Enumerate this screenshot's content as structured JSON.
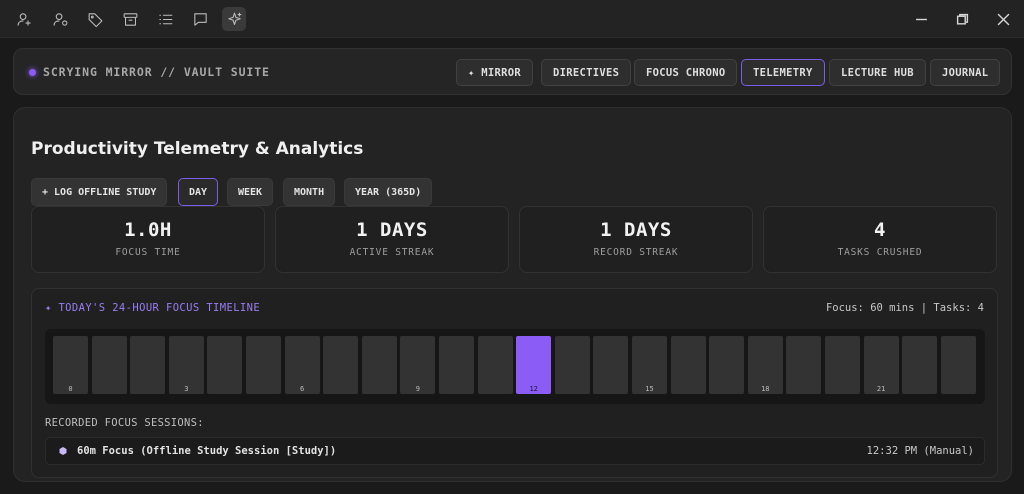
{
  "toolbar": {
    "icons": [
      "user-plus-icon",
      "user-add-icon",
      "tag-icon",
      "archive-icon",
      "list-icon",
      "chat-icon",
      "sparkle-icon"
    ]
  },
  "window": {
    "minimize": "minimize-icon",
    "restore": "restore-icon",
    "close": "close-icon"
  },
  "header": {
    "brand": "SCRYING MIRROR // VAULT SUITE",
    "nav": [
      {
        "label": "✦ MIRROR",
        "active": false
      },
      {
        "label": "DIRECTIVES",
        "active": false
      },
      {
        "label": "FOCUS CHRONO",
        "active": false
      },
      {
        "label": "TELEMETRY",
        "active": true
      },
      {
        "label": "LECTURE HUB",
        "active": false
      },
      {
        "label": "JOURNAL",
        "active": false
      }
    ]
  },
  "main": {
    "title": "Productivity Telemetry & Analytics",
    "log_button": "+ LOG OFFLINE STUDY",
    "ranges": [
      {
        "label": "DAY",
        "active": true
      },
      {
        "label": "WEEK",
        "active": false
      },
      {
        "label": "MONTH",
        "active": false
      },
      {
        "label": "YEAR (365D)",
        "active": false
      }
    ],
    "stats": [
      {
        "value": "1.0H",
        "label": "FOCUS TIME"
      },
      {
        "value": "1 DAYS",
        "label": "ACTIVE STREAK"
      },
      {
        "value": "1 DAYS",
        "label": "RECORD STREAK"
      },
      {
        "value": "4",
        "label": "TASKS CRUSHED"
      }
    ],
    "timeline": {
      "title": "✦ TODAY'S 24-HOUR FOCUS TIMELINE",
      "meta": "Focus: 60 mins | Tasks: 4",
      "hour_labels": [
        "0",
        "3",
        "6",
        "9",
        "12",
        "15",
        "18",
        "21"
      ],
      "active_hours": [
        12
      ]
    },
    "sessions_heading": "RECORDED FOCUS SESSIONS:",
    "sessions": [
      {
        "text": "60m Focus (Offline Study Session [Study])",
        "time": "12:32 PM (Manual)"
      }
    ]
  },
  "colors": {
    "accent": "#8b5cf6",
    "background": "#1a1a1a",
    "panel": "#232323"
  }
}
